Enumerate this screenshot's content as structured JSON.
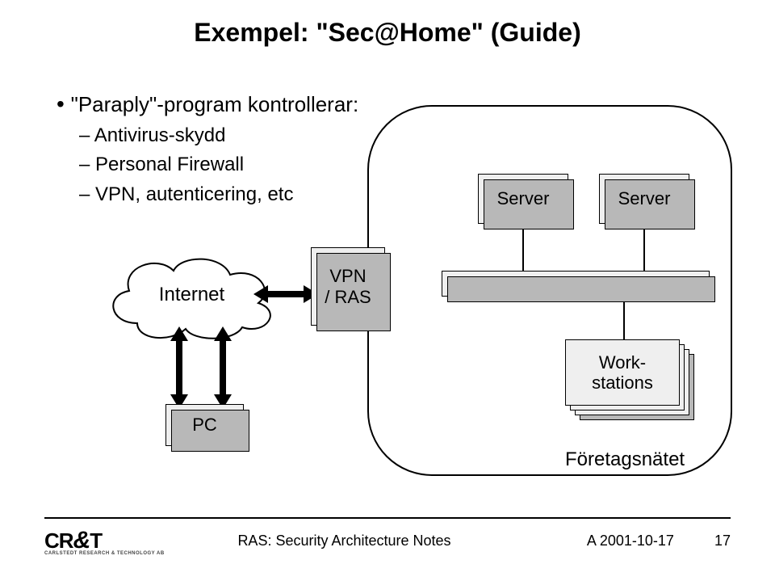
{
  "title": "Exempel: \"Sec@Home\" (Guide)",
  "bullets": {
    "b1": "\"Paraply\"-program kontrollerar:",
    "b2a": "Antivirus-skydd",
    "b2b": "Personal Firewall",
    "b2c": "VPN, autenticering, etc"
  },
  "diagram": {
    "cloud": "Internet",
    "vpn_line1": "VPN",
    "vpn_line2": "/ RAS",
    "server": "Server",
    "workstations_line1": "Work-",
    "workstations_line2": "stations",
    "pc": "PC",
    "network_label": "Företagsnätet"
  },
  "footer": {
    "logo_text_left": "CR",
    "logo_amp": "&",
    "logo_text_right": "T",
    "logo_sub": "CARLSTEDT RESEARCH & TECHNOLOGY AB",
    "center": "RAS: Security Architecture Notes",
    "right": "A 2001-10-17",
    "page": "17"
  }
}
